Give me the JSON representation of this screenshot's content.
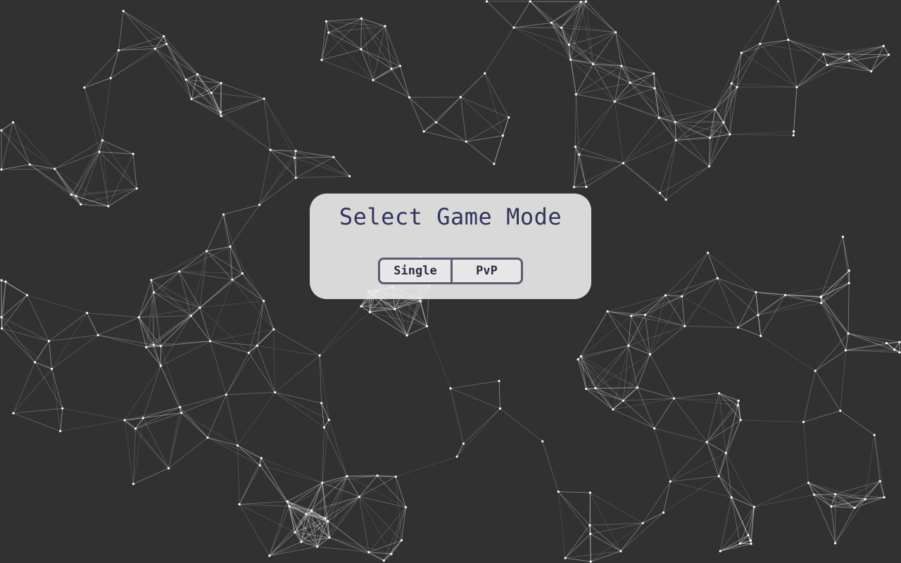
{
  "menu": {
    "title": "Select Game Mode",
    "modes": [
      {
        "label": "Single"
      },
      {
        "label": "PvP"
      }
    ]
  },
  "colors": {
    "background": "#313131",
    "network_line": "#ffffff",
    "panel": "#ececec",
    "title_text": "#33345a",
    "button_border": "#5c5c72"
  }
}
